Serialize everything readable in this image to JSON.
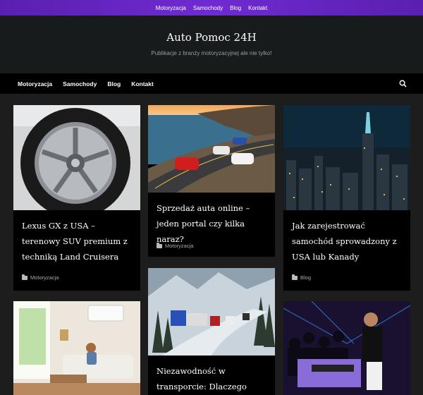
{
  "top_menu": [
    "Motoryzacja",
    "Samochody",
    "Blog",
    "Kontakt"
  ],
  "site": {
    "title": "Auto Pomoc 24H",
    "tagline": "Publikacje z branży motoryzacyjnej ale nie tylko!"
  },
  "main_menu": [
    "Motoryzacja",
    "Samochody",
    "Blog",
    "Kontakt"
  ],
  "icons": {
    "search": "search-icon",
    "category": "folder-icon"
  },
  "posts": [
    {
      "title": "Lexus GX z USA – terenowy SUV premium z techniką Land Cruisera",
      "category": "Motoryzacja",
      "image": "car-wheel"
    },
    {
      "title": "Sprzedaż auta online – jeden portal czy kilka naraz?",
      "category": "Motoryzacja",
      "image": "coastal-road-cars"
    },
    {
      "title": "Jak zarejestrować samochód sprowadzony z USA lub Kanady",
      "category": "Blog",
      "image": "city-skyline-night"
    },
    {
      "title": "",
      "category": "",
      "image": "living-room"
    },
    {
      "title": "Niezawodność w transporcie: Dlaczego profesjonalny",
      "category": "",
      "image": "snowy-highway-trucks"
    },
    {
      "title": "",
      "category": "",
      "image": "dj-party"
    }
  ]
}
